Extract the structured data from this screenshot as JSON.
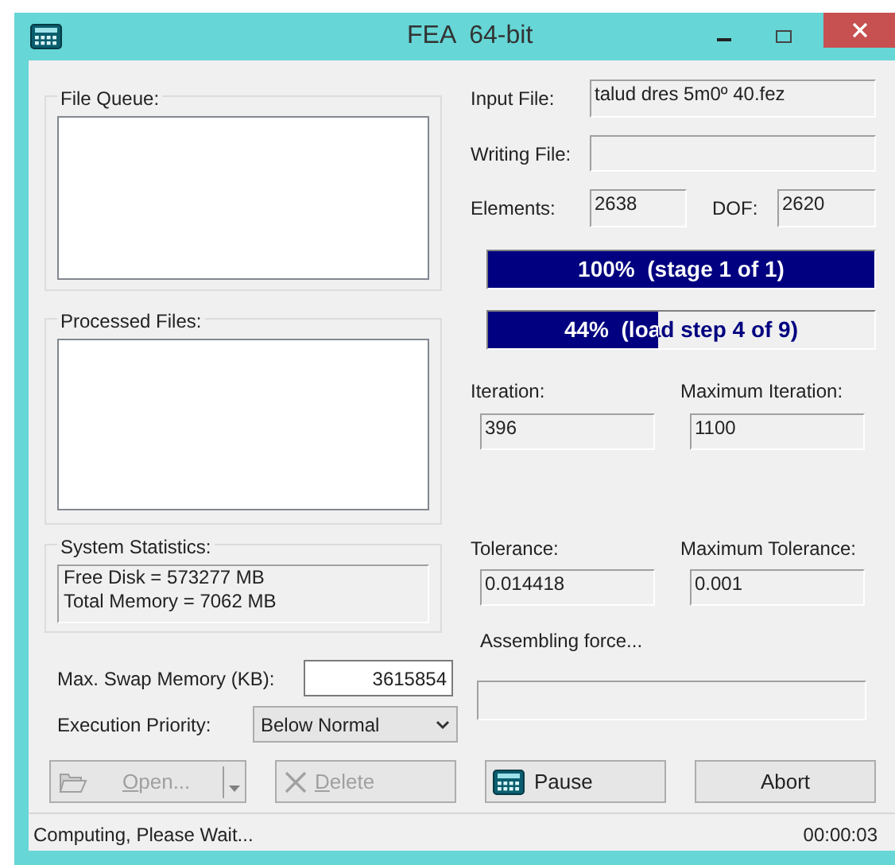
{
  "window": {
    "title": "FEA  64-bit"
  },
  "file_queue": {
    "label": "File Queue:"
  },
  "processed_files": {
    "label": "Processed Files:"
  },
  "system_statistics": {
    "label": "System Statistics:",
    "lines": [
      "Free Disk = 573277 MB",
      "Total Memory = 7062 MB"
    ]
  },
  "max_swap_memory": {
    "label": "Max. Swap Memory (KB):",
    "value": "3615854"
  },
  "execution_priority": {
    "label": "Execution Priority:",
    "value": "Below Normal"
  },
  "input_file": {
    "label": "Input File:",
    "value": "talud dres 5m0º 40.fez"
  },
  "writing_file": {
    "label": "Writing File:"
  },
  "elements": {
    "label": "Elements:",
    "value": "2638"
  },
  "dof": {
    "label": "DOF:",
    "value": "2620"
  },
  "progress": [
    {
      "text": "100%  (stage 1 of 1)",
      "level": 1.0
    },
    {
      "text": "44%  (load step 4 of 9)",
      "level": 0.44
    }
  ],
  "iteration": {
    "label": "Iteration:",
    "value": "396"
  },
  "maximum_iteration": {
    "label": "Maximum Iteration:",
    "value": "1100"
  },
  "tolerance": {
    "label": "Tolerance:",
    "value": "0.014418"
  },
  "maximum_tolerance": {
    "label": "Maximum Tolerance:",
    "value": "0.001"
  },
  "activity": {
    "label": "Assembling force..."
  },
  "buttons": [
    {
      "kind": "open",
      "label": "Open...",
      "disabled": true
    },
    {
      "kind": "delete",
      "label": "Delete",
      "disabled": true
    },
    {
      "kind": "pause",
      "label": "Pause",
      "disabled": false
    },
    {
      "kind": "abort",
      "label": "Abort",
      "disabled": false
    }
  ],
  "status_bar": {
    "message": "Computing, Please Wait...",
    "elapsed": "00:00:03"
  }
}
